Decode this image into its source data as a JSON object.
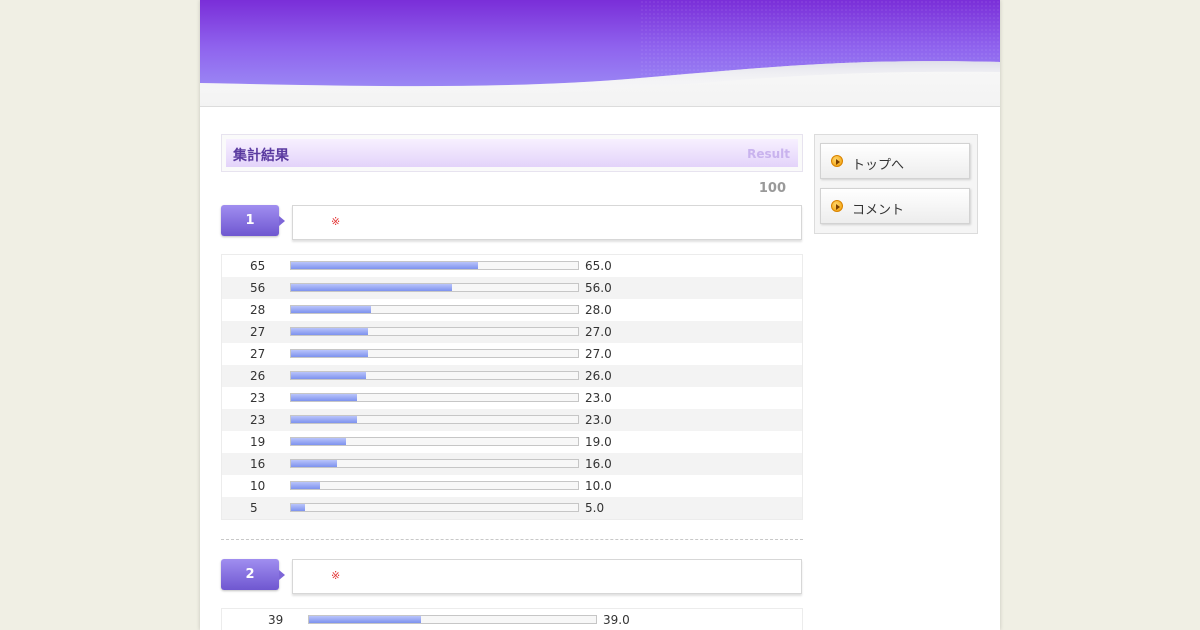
{
  "main": {
    "title": "集計結果",
    "title_sub": "Result",
    "total": "100",
    "mark": "※"
  },
  "questions": [
    {
      "number": "1",
      "rows": [
        {
          "count": "65",
          "percent": "65.0",
          "value": 65.0
        },
        {
          "count": "56",
          "percent": "56.0",
          "value": 56.0
        },
        {
          "count": "28",
          "percent": "28.0",
          "value": 28.0
        },
        {
          "count": "27",
          "percent": "27.0",
          "value": 27.0
        },
        {
          "count": "27",
          "percent": "27.0",
          "value": 27.0
        },
        {
          "count": "26",
          "percent": "26.0",
          "value": 26.0
        },
        {
          "count": "23",
          "percent": "23.0",
          "value": 23.0
        },
        {
          "count": "23",
          "percent": "23.0",
          "value": 23.0
        },
        {
          "count": "19",
          "percent": "19.0",
          "value": 19.0
        },
        {
          "count": "16",
          "percent": "16.0",
          "value": 16.0
        },
        {
          "count": "10",
          "percent": "10.0",
          "value": 10.0
        },
        {
          "count": "5",
          "percent": "5.0",
          "value": 5.0
        }
      ]
    },
    {
      "number": "2",
      "rows": [
        {
          "count": "39",
          "percent": "39.0",
          "value": 39.0
        }
      ]
    }
  ],
  "sidebar": {
    "items": [
      {
        "label": "トップへ",
        "icon": "arrow-right-icon"
      },
      {
        "label": "コメント",
        "icon": "arrow-right-icon"
      }
    ]
  },
  "colors": {
    "header_purple": "#7b3fe0",
    "badge": "#7d66d8",
    "bar": "#8fa0f0",
    "nav_icon": "#f5a800"
  }
}
